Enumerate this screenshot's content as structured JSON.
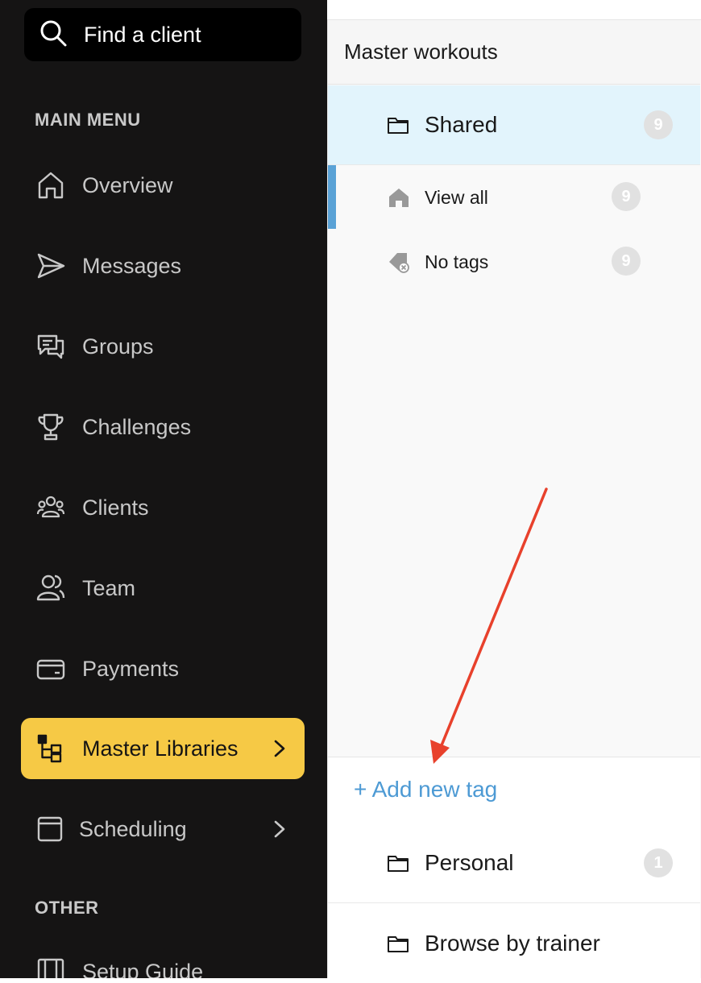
{
  "sidebar": {
    "search": {
      "placeholder": "Find a client",
      "icon": "search-icon"
    },
    "main_menu_label": "MAIN MENU",
    "items": [
      {
        "label": "Overview",
        "icon": "home-icon"
      },
      {
        "label": "Messages",
        "icon": "send-icon"
      },
      {
        "label": "Groups",
        "icon": "chat-bubbles-icon"
      },
      {
        "label": "Challenges",
        "icon": "trophy-icon"
      },
      {
        "label": "Clients",
        "icon": "clients-icon"
      },
      {
        "label": "Team",
        "icon": "team-icon"
      },
      {
        "label": "Payments",
        "icon": "wallet-icon"
      },
      {
        "label": "Master Libraries",
        "icon": "hierarchy-icon",
        "active": true
      },
      {
        "label": "Scheduling",
        "icon": "calendar-icon"
      }
    ],
    "other_label": "OTHER",
    "other_items": [
      {
        "label": "Setup Guide",
        "icon": "book-icon"
      }
    ],
    "active_color": "#f6c945",
    "background": "#151414"
  },
  "panel": {
    "title": "Master workouts",
    "shared": {
      "label": "Shared",
      "count": "9"
    },
    "tags": [
      {
        "label": "View all",
        "count": "9",
        "icon": "home-icon"
      },
      {
        "label": "No tags",
        "count": "9",
        "icon": "tag-remove-icon"
      }
    ],
    "add_tag_label": "+ Add new tag",
    "personal": {
      "label": "Personal",
      "count": "1"
    },
    "browse": {
      "label": "Browse by trainer"
    },
    "accent_color": "#5aa2d6",
    "link_color": "#4d9ad4"
  },
  "annotation": {
    "type": "arrow",
    "color": "#e8412c"
  }
}
